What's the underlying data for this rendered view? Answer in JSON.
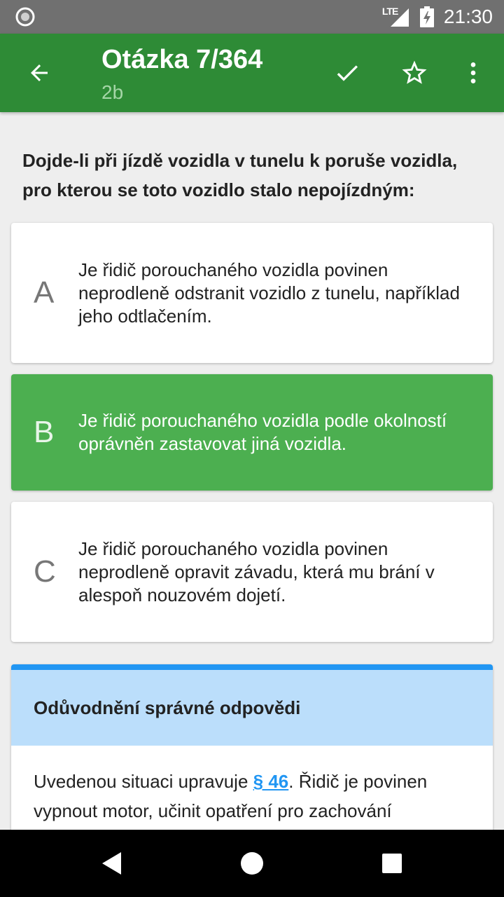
{
  "status_bar": {
    "network": "LTE",
    "time": "21:30",
    "left_icon": "record-icon",
    "battery_icon": "battery-charging-icon"
  },
  "app_bar": {
    "title": "Otázka 7/364",
    "subtitle": "2b",
    "back_icon": "arrow-back-icon",
    "actions": [
      "check-icon",
      "star-outline-icon",
      "more-vert-icon"
    ],
    "color": "#2e8b36"
  },
  "question": {
    "text": "Dojde-li při jízdě vozidla v tunelu k poruše vozidla, pro kterou se toto vozidlo stalo nepojízdným:"
  },
  "answers": [
    {
      "letter": "A",
      "text": "Je řidič porouchaného vozidla povinen neprodleně odstranit vozidlo z tunelu, například jeho odtlačením.",
      "state": "default"
    },
    {
      "letter": "B",
      "text": "Je řidič porouchaného vozidla podle okolností oprávněn zastavovat jiná vozidla.",
      "state": "correct",
      "color": "#4caf50"
    },
    {
      "letter": "C",
      "text": "Je řidič porouchaného vozidla povinen neprodleně opravit závadu, která mu brání v alespoň nouzovém dojetí.",
      "state": "default"
    }
  ],
  "explanation": {
    "title": "Odůvodnění správné odpovědi",
    "text_before": "Uvedenou situaci upravuje ",
    "link": "§ 46",
    "text_after": ". Řidič je povinen vypnout motor, učinit opatření pro zachování",
    "header_color": "#bbdefb",
    "accent_color": "#2196f3"
  },
  "nav_bar": {
    "icons": [
      "nav-back-icon",
      "nav-home-icon",
      "nav-recents-icon"
    ]
  }
}
